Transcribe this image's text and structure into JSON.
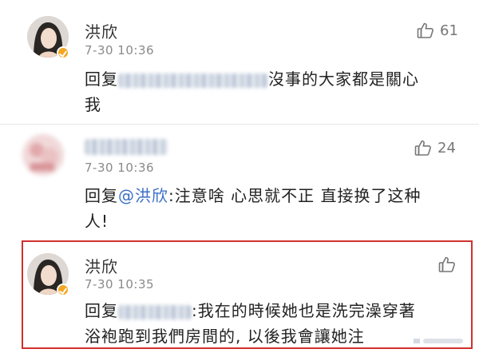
{
  "comments": [
    {
      "name": "洪欣",
      "time": "7-30 10:36",
      "likes": "61",
      "reply_prefix": "回复",
      "text": "沒事的大家都是關心",
      "text_cont": "我",
      "verified": true
    },
    {
      "time": "7-30 10:36",
      "likes": "24",
      "reply_prefix": "回复",
      "mention": "@洪欣",
      "text": ":注意啥 心思就不正 直接换了这种",
      "text_cont": "人!",
      "verified": false
    },
    {
      "name": "洪欣",
      "time": "7-30 10:35",
      "likes": "",
      "reply_prefix": "回复",
      "text": ":我在的時候她也是洗完澡穿著",
      "text_cont": "浴袍跑到我們房間的, 以後我會讓她注",
      "verified": true
    }
  ],
  "icons": {
    "like": "thumbs-up-icon",
    "verified": "verified-badge-icon"
  },
  "colors": {
    "highlight": "#d0312d",
    "mention": "#3b6fc7",
    "verified": "#f5a623"
  }
}
